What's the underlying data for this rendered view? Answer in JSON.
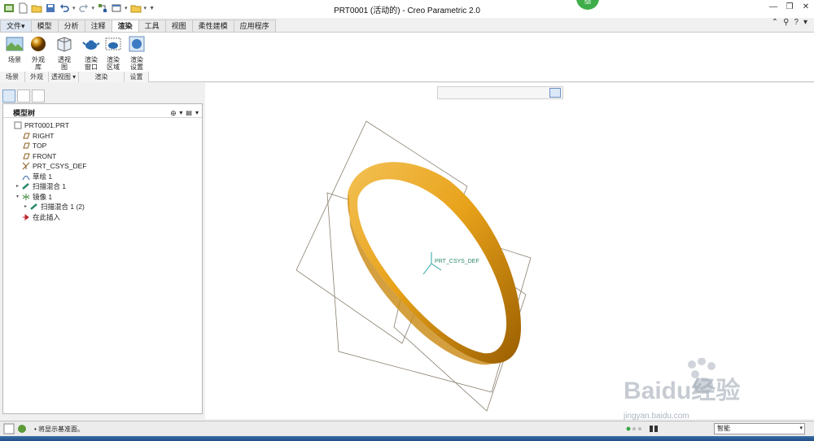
{
  "window": {
    "title": "PRT0001 (活动的) - Creo Parametric 2.0",
    "badge": "58"
  },
  "tabs": [
    {
      "label": "文件",
      "caret": "▾"
    },
    {
      "label": "模型"
    },
    {
      "label": "分析"
    },
    {
      "label": "注释"
    },
    {
      "label": "渲染"
    },
    {
      "label": "工具"
    },
    {
      "label": "视图"
    },
    {
      "label": "柔性建模"
    },
    {
      "label": "应用程序"
    }
  ],
  "ribbon": {
    "buttons": [
      {
        "label": "场景"
      },
      {
        "label": "外观\n库",
        "caret": "▾"
      },
      {
        "label": "透视\n图"
      },
      {
        "label": "渲染\n窗口"
      },
      {
        "label": "渲染\n区域"
      },
      {
        "label": "渲染\n设置"
      }
    ],
    "groups": [
      {
        "label": "场景"
      },
      {
        "label": "外观"
      },
      {
        "label": "透视图 ▾"
      },
      {
        "label": "渲染"
      },
      {
        "label": "设置"
      }
    ]
  },
  "model_tree": {
    "title": "模型树",
    "items": [
      {
        "label": "PRT0001.PRT",
        "icon": "part-icon",
        "indent": 0,
        "toggle": ""
      },
      {
        "label": "RIGHT",
        "icon": "datum-plane-icon",
        "indent": 1,
        "toggle": ""
      },
      {
        "label": "TOP",
        "icon": "datum-plane-icon",
        "indent": 1,
        "toggle": ""
      },
      {
        "label": "FRONT",
        "icon": "datum-plane-icon",
        "indent": 1,
        "toggle": ""
      },
      {
        "label": "PRT_CSYS_DEF",
        "icon": "csys-icon",
        "indent": 1,
        "toggle": ""
      },
      {
        "label": "草绘 1",
        "icon": "sketch-icon",
        "indent": 1,
        "toggle": ""
      },
      {
        "label": "扫描混合 1",
        "icon": "sweep-blend-icon",
        "indent": 1,
        "toggle": "▸"
      },
      {
        "label": "镜像 1",
        "icon": "mirror-icon",
        "indent": 1,
        "toggle": "▾"
      },
      {
        "label": "扫描混合 1 (2)",
        "icon": "sweep-blend-icon",
        "indent": 2,
        "toggle": "▸"
      },
      {
        "label": "在此插入",
        "icon": "insert-here-icon",
        "indent": 1,
        "toggle": ""
      }
    ]
  },
  "graphics": {
    "csys_label": "PRT_CSYS_DEF",
    "ring_color": "#e8a21a"
  },
  "status": {
    "message": "• 将显示基准面。",
    "filter_value": "智能"
  },
  "watermark": {
    "brand": "Baidu经验",
    "url": "jingyan.baidu.com"
  }
}
